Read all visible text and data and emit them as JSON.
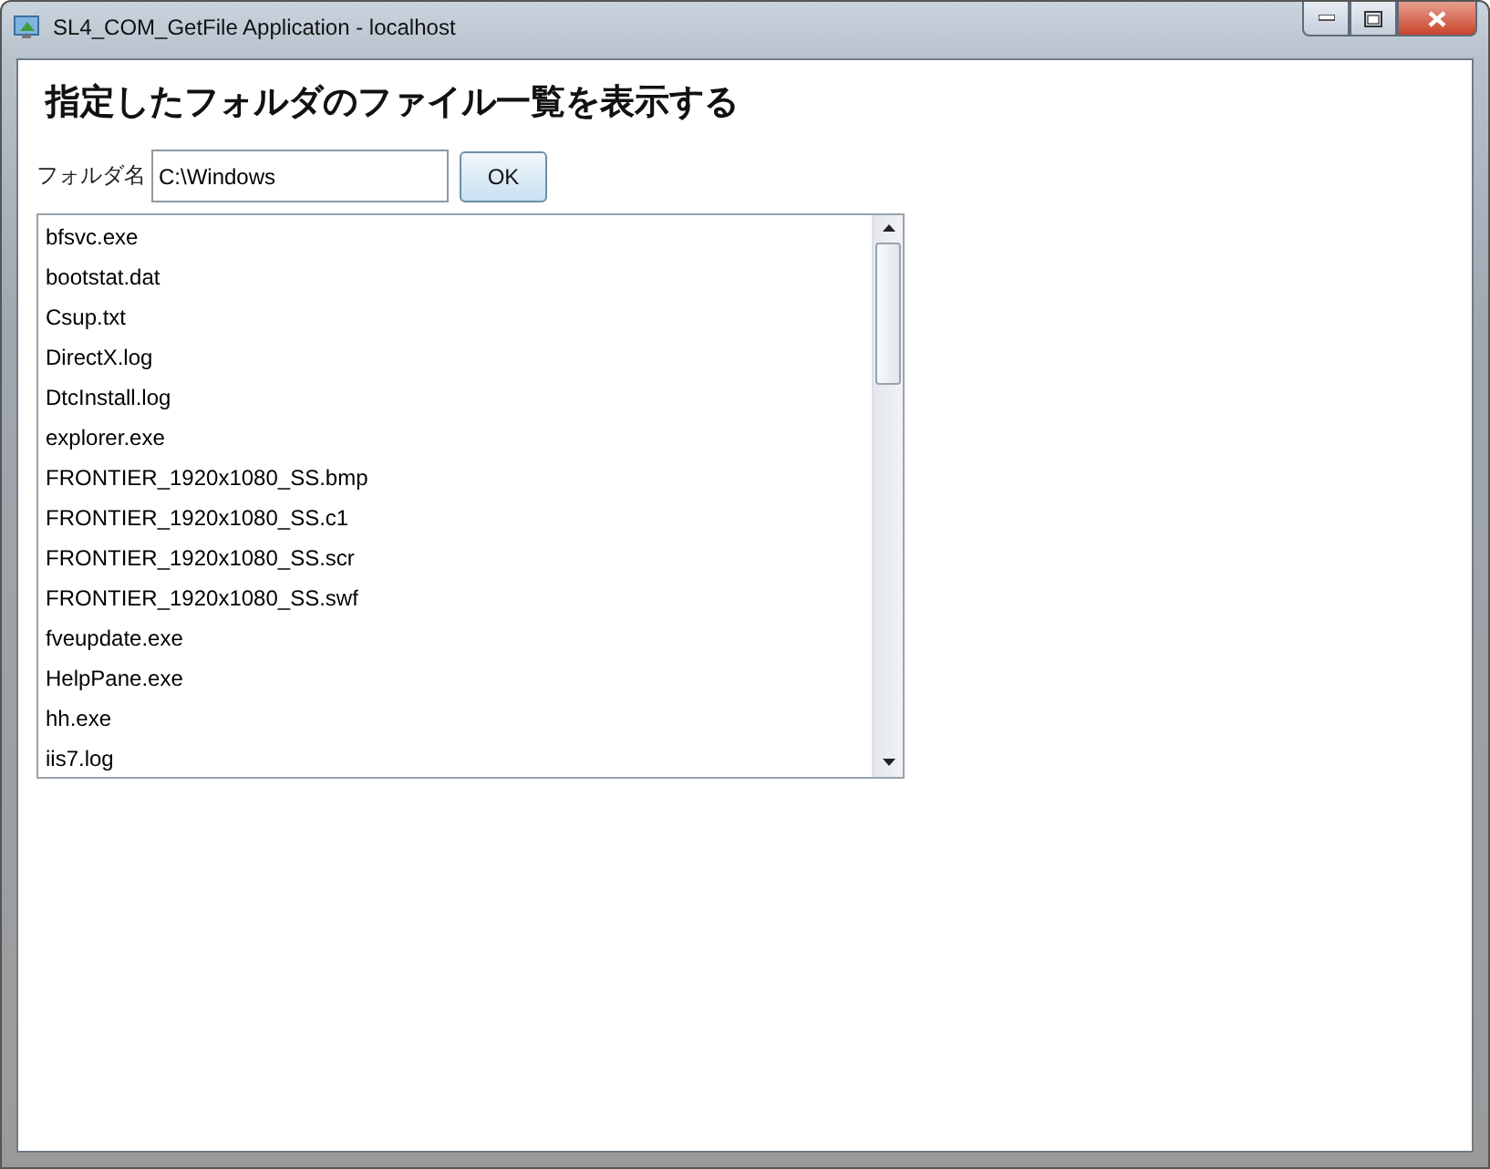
{
  "window": {
    "title": "SL4_COM_GetFile Application - localhost"
  },
  "heading": "指定したフォルダのファイル一覧を表示する",
  "folder_label": "フォルダ名",
  "folder_field": {
    "value": "C:\\Windows"
  },
  "ok_button": "OK",
  "files": [
    "bfsvc.exe",
    "bootstat.dat",
    "Csup.txt",
    "DirectX.log",
    "DtcInstall.log",
    "explorer.exe",
    "FRONTIER_1920x1080_SS.bmp",
    "FRONTIER_1920x1080_SS.c1",
    "FRONTIER_1920x1080_SS.scr",
    "FRONTIER_1920x1080_SS.swf",
    "fveupdate.exe",
    "HelpPane.exe",
    "hh.exe",
    "iis7.log"
  ]
}
